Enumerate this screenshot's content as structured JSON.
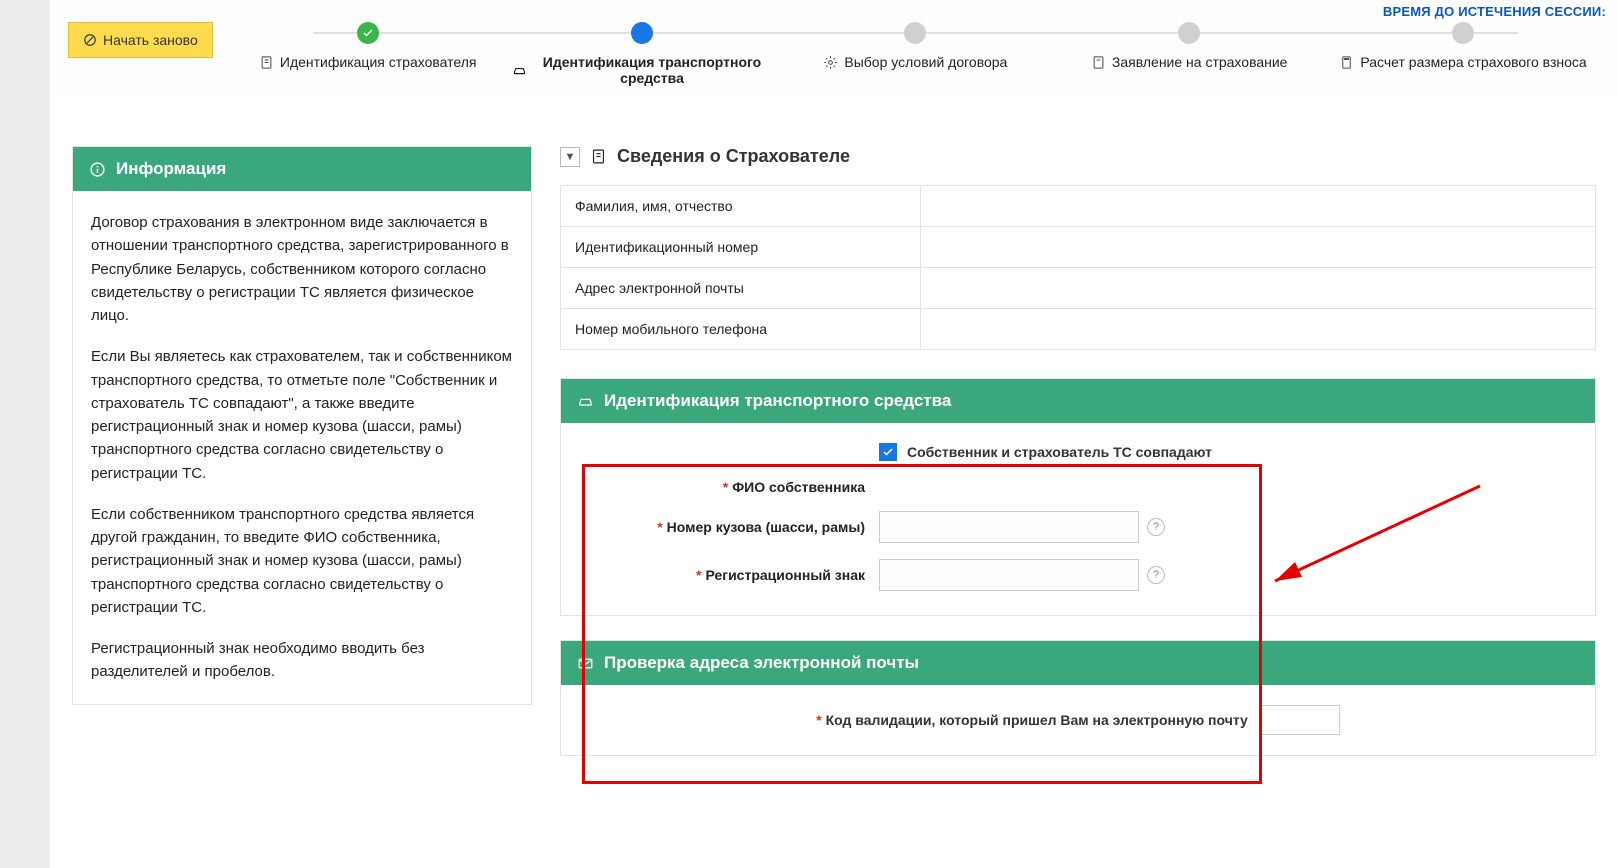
{
  "header": {
    "session_label": "ВРЕМЯ ДО ИСТЕЧЕНИЯ СЕССИИ:",
    "restart_label": "Начать заново"
  },
  "steps": {
    "s1": "Идентификация страхователя",
    "s2": "Идентификация транспортного средства",
    "s3": "Выбор условий договора",
    "s4": "Заявление на страхование",
    "s5": "Расчет размера страхового взноса"
  },
  "info": {
    "title": "Информация",
    "p1": "Договор страхования в электронном виде заключается в отношении транспортного средства, зарегистрированного в Республике Беларусь, собственником которого согласно свидетельству о регистрации ТС является физическое лицо.",
    "p2": "Если Вы являетесь как страхователем, так и собственником транспортного средства, то отметьте поле \"Собственник и страхователь ТС совпадают\", а также введите регистрационный знак и номер кузова (шасси, рамы) транспортного средства согласно свидетельству о регистрации ТС.",
    "p3": "Если собственником транспортного средства является другой гражданин, то введите ФИО собственника, регистрационный знак и номер кузова (шасси, рамы) транспортного средства согласно свидетельству о регистрации ТС.",
    "p4": "Регистрационный знак необходимо вводить без разделителей и пробелов."
  },
  "insured": {
    "section_title": "Сведения о Страхователе",
    "rows": {
      "fio": "Фамилия, имя, отчество",
      "id": "Идентификационный номер",
      "email": "Адрес электронной почты",
      "phone": "Номер мобильного телефона"
    },
    "values": {
      "fio": "",
      "id": "",
      "email": "",
      "phone": ""
    }
  },
  "vehicle": {
    "section_title": "Идентификация транспортного средства",
    "same_label": "Собственник и страхователь ТС совпадают",
    "same_checked": true,
    "owner_label": "ФИО собственника",
    "body_label": "Номер кузова (шасси, рамы)",
    "reg_label": "Регистрационный знак",
    "owner_value": "",
    "body_value": "",
    "reg_value": ""
  },
  "emailcheck": {
    "section_title": "Проверка адреса электронной почты",
    "code_label": "Код валидации, который пришел Вам на электронную почту",
    "code_value": ""
  }
}
